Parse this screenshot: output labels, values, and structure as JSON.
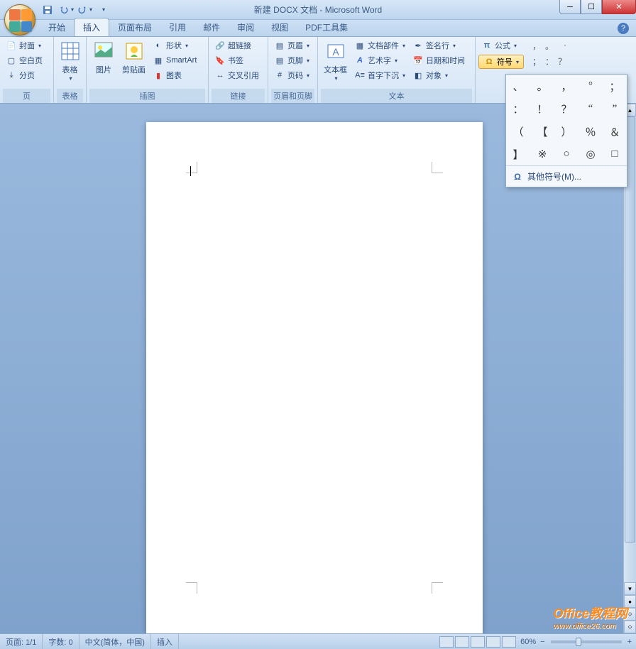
{
  "title": "新建 DOCX 文档 - Microsoft Word",
  "qat": {
    "save": "save-icon",
    "undo": "undo-icon",
    "redo": "redo-icon"
  },
  "tabs": [
    "开始",
    "插入",
    "页面布局",
    "引用",
    "邮件",
    "审阅",
    "视图",
    "PDF工具集"
  ],
  "active_tab_index": 1,
  "ribbon": {
    "groups": [
      {
        "label": "页",
        "items": [
          "封面",
          "空白页",
          "分页"
        ]
      },
      {
        "label": "表格",
        "items": [
          "表格"
        ]
      },
      {
        "label": "插图",
        "items": [
          "图片",
          "剪贴画",
          "形状",
          "SmartArt",
          "图表"
        ]
      },
      {
        "label": "链接",
        "items": [
          "超链接",
          "书签",
          "交叉引用"
        ]
      },
      {
        "label": "页眉和页脚",
        "items": [
          "页眉",
          "页脚",
          "页码"
        ]
      },
      {
        "label": "文本",
        "items": [
          "文本框",
          "文档部件",
          "艺术字",
          "首字下沉",
          "签名行",
          "日期和时间",
          "对象"
        ]
      },
      {
        "label": "符号",
        "items": [
          "公式",
          "符号"
        ]
      }
    ]
  },
  "mini_symbols_row1": [
    "，",
    "。",
    "：",
    "；",
    "？"
  ],
  "dropdown": {
    "grid": [
      "、",
      "。",
      "，",
      "°",
      "；",
      "：",
      "！",
      "？",
      "“",
      "”",
      "（",
      "【",
      "）",
      "％",
      "＆",
      "】",
      "※",
      "○",
      "◎",
      "□"
    ],
    "more_label": "其他符号(M)..."
  },
  "statusbar": {
    "page": "页面: 1/1",
    "words": "字数: 0",
    "lang": "中文(简体，中国)",
    "mode": "插入",
    "zoom": "60%"
  },
  "watermark": {
    "big": "Office教程网",
    "small": "www.office26.com"
  }
}
